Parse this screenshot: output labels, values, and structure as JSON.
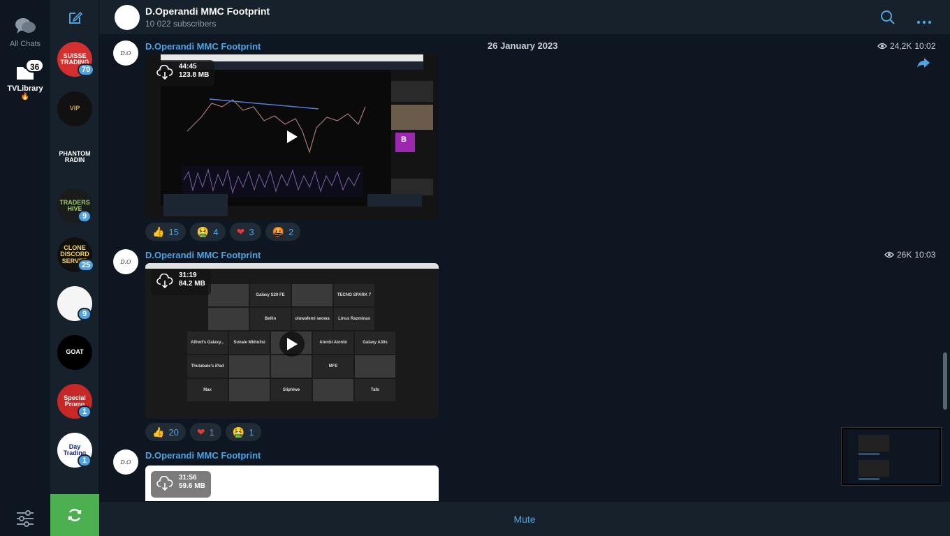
{
  "rail": {
    "all_chats": "All Chats",
    "folder_name": "TVLibrary",
    "folder_flame": "🔥",
    "folder_badge": "36"
  },
  "chats": [
    {
      "name": "SUISSE TRADING",
      "badge": "70",
      "color": "#d32f2f",
      "text_color": "#ffffff"
    },
    {
      "name": "VIP",
      "badge": "",
      "color": "#111111",
      "text_color": "#c9a44c"
    },
    {
      "name": "PHANTOM RADIN",
      "badge": "",
      "color": "#17212b",
      "text_color": "#ffffff"
    },
    {
      "name": "TRADERS HIVE",
      "badge": "9",
      "color": "#1b1b1b",
      "text_color": "#9ccc65"
    },
    {
      "name": "CLONE DISCORD SERVER",
      "badge": "25",
      "color": "#101010",
      "text_color": "#ffd54f"
    },
    {
      "name": "",
      "badge": "9",
      "color": "#f5f5f5",
      "text_color": "#111111"
    },
    {
      "name": "GOAT",
      "badge": "",
      "color": "#000000",
      "text_color": "#ffffff"
    },
    {
      "name": "Special Promo",
      "badge": "1",
      "color": "#c62828",
      "text_color": "#ffffff"
    },
    {
      "name": "Day Trading",
      "badge": "1",
      "color": "#ffffff",
      "text_color": "#1a237e"
    }
  ],
  "header": {
    "title": "D.Operandi MMC Footprint",
    "subscribers": "10 022 subscribers"
  },
  "date_divider": "26 January 2023",
  "messages": [
    {
      "sender": "D.Operandi MMC Footprint",
      "views": "24,2K",
      "time": "10:02",
      "duration": "44:45",
      "size": "123.8 MB",
      "reactions": [
        {
          "emoji": "👍",
          "count": "15"
        },
        {
          "emoji": "🤮",
          "count": "4"
        },
        {
          "emoji": "❤",
          "count": "3"
        },
        {
          "emoji": "🤬",
          "count": "2"
        }
      ]
    },
    {
      "sender": "D.Operandi MMC Footprint",
      "views": "26K",
      "time": "10:03",
      "duration": "31:19",
      "size": "84.2 MB",
      "reactions": [
        {
          "emoji": "👍",
          "count": "20"
        },
        {
          "emoji": "❤",
          "count": "1"
        },
        {
          "emoji": "🤮",
          "count": "1"
        }
      ]
    },
    {
      "sender": "D.Operandi MMC Footprint",
      "duration": "31:56",
      "size": "59.6 MB"
    }
  ],
  "zoom_tiles": [
    [
      "",
      "Galaxy S20 FE",
      "",
      "TECNO SPARK 7"
    ],
    [
      "",
      "Bellin",
      "oluwafemi seowa",
      "Linus Razminas"
    ],
    [
      "Alfred's Galaxy...",
      "Sunale Mkhulisi",
      "",
      "Atonbi Atonbi",
      "Galaxy A30s"
    ],
    [
      "Thulabale's iPad",
      "",
      "",
      "MFE",
      ""
    ],
    [
      "Max",
      "",
      "Sliphiwe",
      "",
      "Tafo"
    ]
  ],
  "video_avatar_letter": "B",
  "composer": {
    "mute_label": "Mute"
  }
}
